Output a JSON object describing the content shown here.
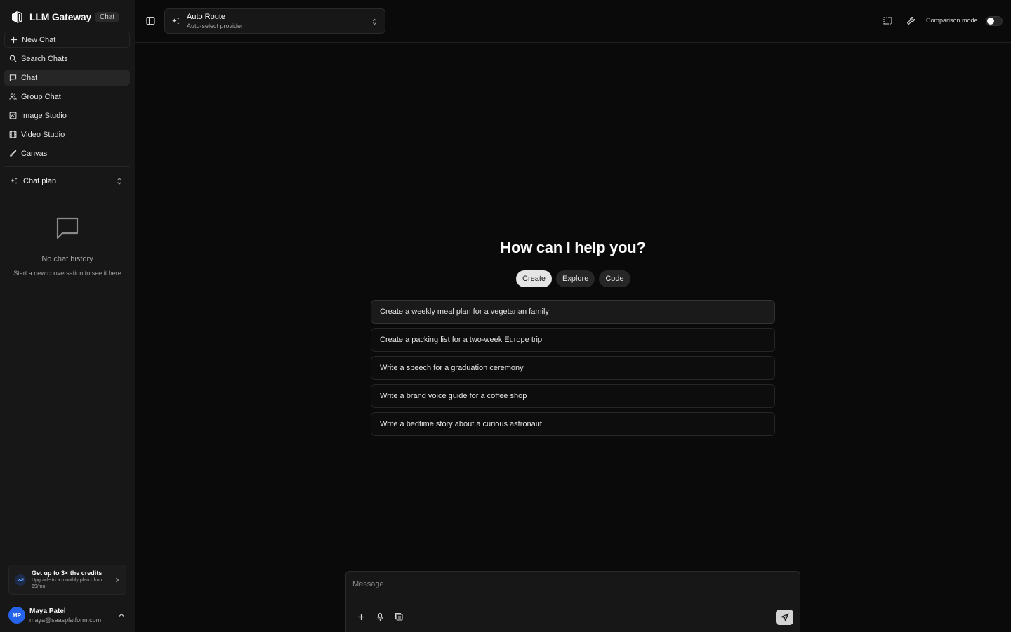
{
  "brand": {
    "name": "LLM Gateway",
    "badge": "Chat"
  },
  "sidebar": {
    "items": [
      {
        "label": "New Chat",
        "icon": "plus-icon"
      },
      {
        "label": "Search Chats",
        "icon": "search-icon"
      },
      {
        "label": "Chat",
        "icon": "message-icon",
        "active": true
      },
      {
        "label": "Group Chat",
        "icon": "users-icon"
      },
      {
        "label": "Image Studio",
        "icon": "image-icon"
      },
      {
        "label": "Video Studio",
        "icon": "film-icon"
      },
      {
        "label": "Canvas",
        "icon": "brush-icon"
      }
    ],
    "plan_label": "Chat plan",
    "empty_title": "No chat history",
    "empty_subtitle": "Start a new conversation to see it here",
    "promo": {
      "title": "Get up to 3× the credits",
      "subtitle": "Upgrade to a monthly plan · from $9/mo"
    },
    "user": {
      "initials": "MP",
      "name": "Maya Patel",
      "email": "maya@saasplatform.com"
    }
  },
  "topbar": {
    "model_name": "Auto Route",
    "model_sub": "Auto-select provider",
    "comparison_label": "Comparison mode",
    "comparison_on": false
  },
  "main": {
    "heading": "How can I help you?",
    "tabs": [
      {
        "label": "Create",
        "active": true
      },
      {
        "label": "Explore",
        "active": false
      },
      {
        "label": "Code",
        "active": false
      }
    ],
    "suggestions": [
      "Create a weekly meal plan for a vegetarian family",
      "Create a packing list for a two-week Europe trip",
      "Write a speech for a graduation ceremony",
      "Write a brand voice guide for a coffee shop",
      "Write a bedtime story about a curious astronaut"
    ]
  },
  "composer": {
    "placeholder": "Message"
  },
  "colors": {
    "background": "#0a0a0a",
    "sidebar": "#171717",
    "avatar": "#2563eb"
  }
}
